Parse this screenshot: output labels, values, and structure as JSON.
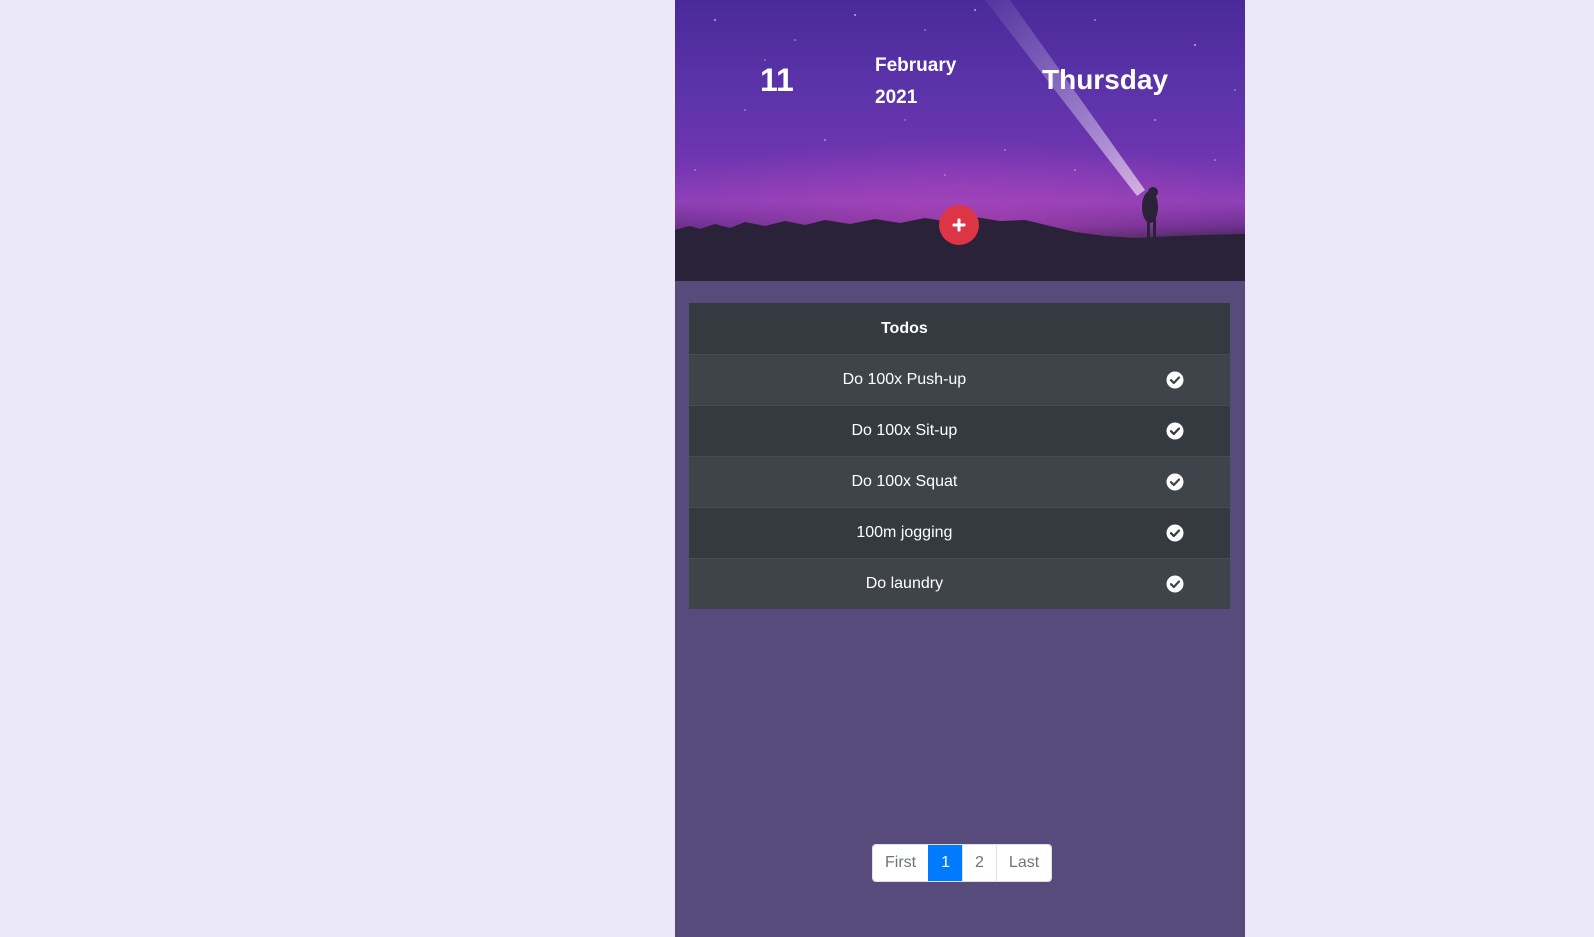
{
  "header": {
    "day": "11",
    "month": "February",
    "year": "2021",
    "weekday": "Thursday",
    "add_button_icon": "plus-icon"
  },
  "table": {
    "header": "Todos",
    "rows": [
      {
        "title": "Do 100x Push-up",
        "icon": "check-circle-icon"
      },
      {
        "title": "Do 100x Sit-up",
        "icon": "check-circle-icon"
      },
      {
        "title": "Do 100x Squat",
        "icon": "check-circle-icon"
      },
      {
        "title": "100m jogging",
        "icon": "check-circle-icon"
      },
      {
        "title": "Do laundry",
        "icon": "check-circle-icon"
      }
    ]
  },
  "pagination": {
    "first": "First",
    "pages": [
      "1",
      "2"
    ],
    "active": "1",
    "last": "Last"
  },
  "colors": {
    "page_background": "#ebe9f9",
    "panel_background": "#574b7c",
    "add_button": "#dc3545",
    "table_dark": "#343a40",
    "table_striped": "#3e444a",
    "pagination_active": "#007bff"
  }
}
